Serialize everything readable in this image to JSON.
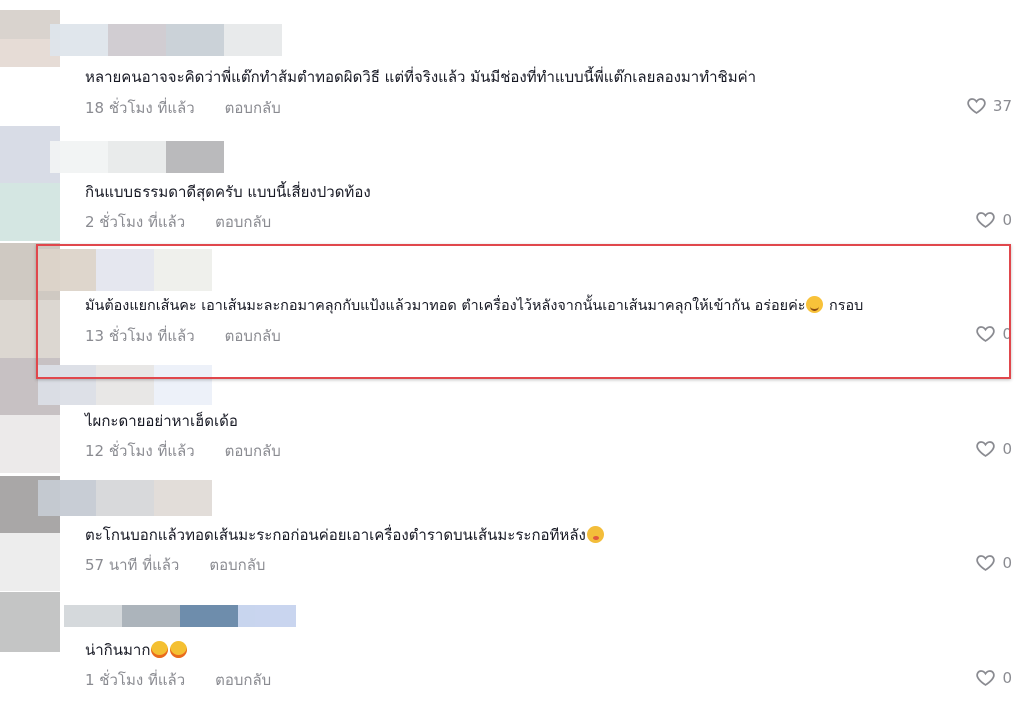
{
  "comments": [
    {
      "text": "หลายคนอาจจะคิดว่าพี่แต๊กทำส้มตำทอดผิดวิธี แต่ที่จริงแล้ว มันมีช่องที่ทำแบบนี้พี่แต๊กเลยลองมาทำชิมค่า",
      "time": "18 ชั่วโมง ที่แล้ว",
      "reply": "ตอบกลับ",
      "likes": "37",
      "emoji": ""
    },
    {
      "text": "กินแบบธรรมดาดีสุดครับ แบบนี้เสี่ยงปวดท้อง",
      "time": "2 ชั่วโมง ที่แล้ว",
      "reply": "ตอบกลับ",
      "likes": "0",
      "emoji": ""
    },
    {
      "text": "มันต้องแยกเส้นคะ เอาเส้นมะละกอมาคลุกกับแป้งแล้วมาทอด ตำเครื่องไว้หลังจากนั้นเอาเส้นมาคลุกให้เข้ากัน อร่อยค่ะ",
      "text_after": " กรอบ",
      "time": "13 ชั่วโมง ที่แล้ว",
      "reply": "ตอบกลับ",
      "likes": "0",
      "emoji": "smiling-face"
    },
    {
      "text": "ไผกะดายอย่าหาเฮ็ดเด้อ",
      "time": "12 ชั่วโมง ที่แล้ว",
      "reply": "ตอบกลับ",
      "likes": "0",
      "emoji": ""
    },
    {
      "text": "ตะโกนบอกแล้วทอดเส้นมะระกอก่อนค่อยเอาเครื่องตำราดบนเส้นมะระกอทีหลัง",
      "time": "57 นาที ที่แล้ว",
      "reply": "ตอบกลับ",
      "likes": "0",
      "emoji": "dizzy-face"
    },
    {
      "text": "น่ากินมาก",
      "time": "1 ชั่วโมง ที่แล้ว",
      "reply": "ตอบกลับ",
      "likes": "0",
      "emoji": "rolling-laughing-face"
    }
  ],
  "colors": {
    "highlight_border": "#e0474c",
    "meta_text": "#8a8b91",
    "comment_text": "#161823"
  }
}
